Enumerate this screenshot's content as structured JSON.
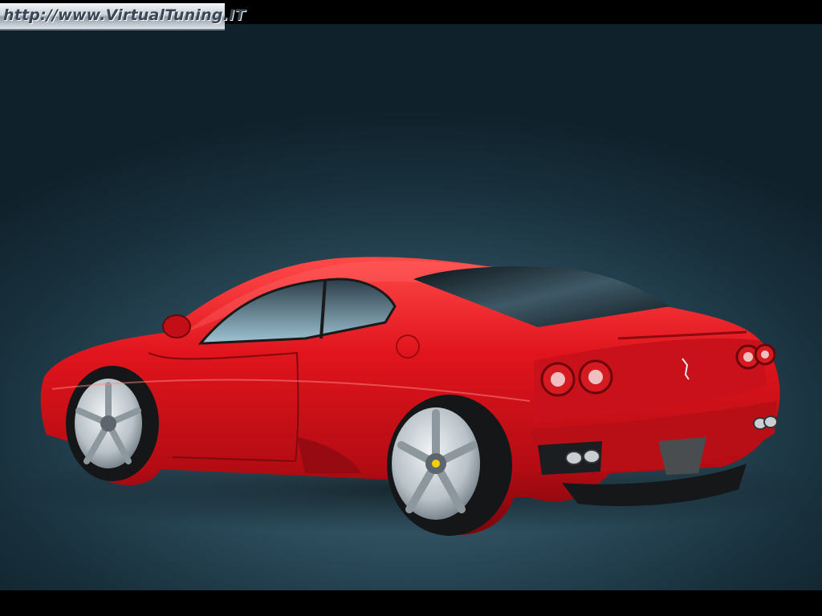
{
  "watermark": {
    "text": "http://www.VirtualTuning.IT"
  },
  "photo": {
    "subject": "car-rear-three-quarter",
    "colors": {
      "body": "#d4141c",
      "background": "#2b4a5a",
      "frame": "#000000"
    }
  }
}
